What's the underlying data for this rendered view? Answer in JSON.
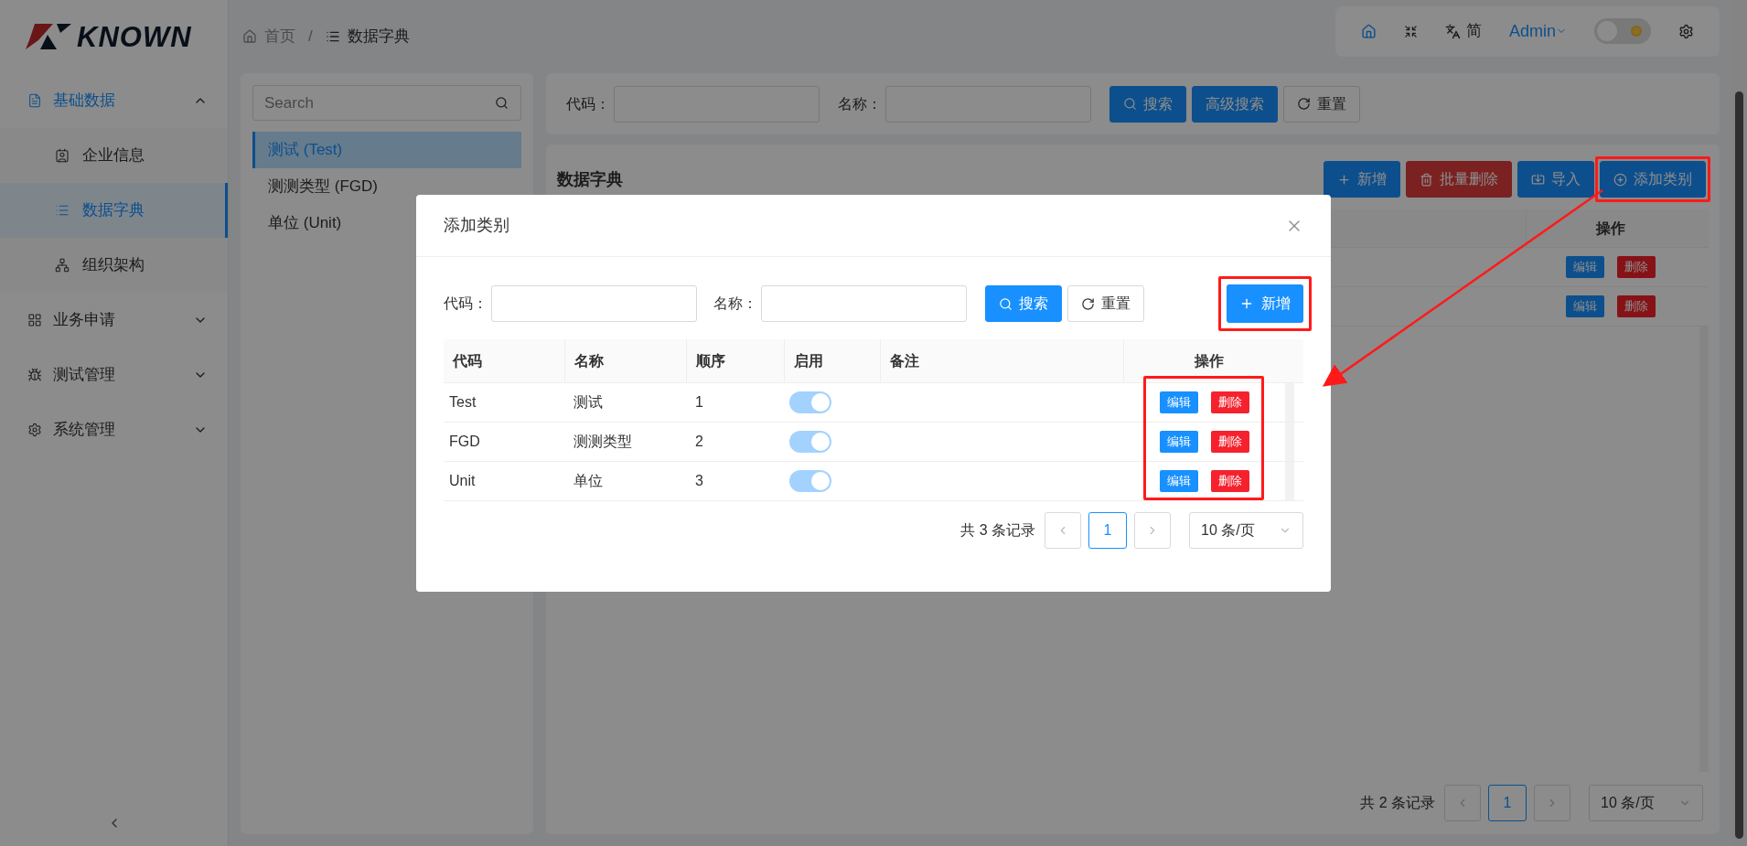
{
  "logo": {
    "text": "KNOWN"
  },
  "sidebar": {
    "items": [
      {
        "label": "基础数据",
        "kind": "data",
        "expanded": true,
        "children": [
          {
            "label": "企业信息",
            "kind": "company",
            "selected": false
          },
          {
            "label": "数据字典",
            "kind": "dictionary",
            "selected": true
          },
          {
            "label": "组织架构",
            "kind": "org",
            "selected": false
          }
        ]
      },
      {
        "label": "业务申请",
        "kind": "apply",
        "expanded": false
      },
      {
        "label": "测试管理",
        "kind": "test",
        "expanded": false
      },
      {
        "label": "系统管理",
        "kind": "system",
        "expanded": false
      }
    ]
  },
  "breadcrumb": {
    "separator": "/",
    "items": [
      {
        "label": "首页",
        "kind": "home"
      },
      {
        "label": "数据字典",
        "kind": "list"
      }
    ]
  },
  "header": {
    "language": "简",
    "user": "Admin",
    "dark_mode": false
  },
  "tree": {
    "search_placeholder": "Search",
    "items": [
      {
        "label": "测试 (Test)",
        "selected": true
      },
      {
        "label": "测测类型 (FGD)",
        "selected": false
      },
      {
        "label": "单位 (Unit)",
        "selected": false
      }
    ]
  },
  "filter": {
    "fields": [
      {
        "label": "代码："
      },
      {
        "label": "名称："
      }
    ],
    "buttons": [
      {
        "label": "搜索",
        "kind": "search"
      },
      {
        "label": "高级搜索",
        "kind": "advanced"
      },
      {
        "label": "重置",
        "kind": "reset"
      }
    ]
  },
  "panel": {
    "title": "数据字典",
    "actions": [
      {
        "label": "新增",
        "kind": "add",
        "highlighted": false
      },
      {
        "label": "批量删除",
        "kind": "batch_delete",
        "highlighted": false
      },
      {
        "label": "导入",
        "kind": "import",
        "highlighted": false
      },
      {
        "label": "添加类别",
        "kind": "add_category",
        "highlighted": true
      }
    ],
    "table": {
      "action_header": "操作",
      "rows": [
        {
          "actions": [
            {
              "label": "编辑",
              "kind": "edit"
            },
            {
              "label": "删除",
              "kind": "delete"
            }
          ]
        },
        {
          "actions": [
            {
              "label": "编辑",
              "kind": "edit"
            },
            {
              "label": "删除",
              "kind": "delete"
            }
          ]
        }
      ]
    },
    "pagination": {
      "total": "共 2 条记录",
      "pages": [
        {
          "label": "1",
          "selected": true
        }
      ],
      "page_size": "10 条/页"
    }
  },
  "dialog": {
    "title": "添加类别",
    "fields": [
      {
        "label": "代码："
      },
      {
        "label": "名称："
      }
    ],
    "buttons": [
      {
        "label": "搜索",
        "kind": "search"
      },
      {
        "label": "重置",
        "kind": "reset"
      }
    ],
    "add_button": {
      "label": "新增",
      "highlighted": true
    },
    "table": {
      "columns": [
        "代码",
        "名称",
        "顺序",
        "启用",
        "备注",
        "操作"
      ],
      "actions_highlighted": true,
      "rows": [
        {
          "code": "Test",
          "name": "测试",
          "order": "1",
          "enabled": true,
          "actions": [
            {
              "label": "编辑",
              "kind": "edit"
            },
            {
              "label": "删除",
              "kind": "delete"
            }
          ]
        },
        {
          "code": "FGD",
          "name": "测测类型",
          "order": "2",
          "enabled": true,
          "actions": [
            {
              "label": "编辑",
              "kind": "edit"
            },
            {
              "label": "删除",
              "kind": "delete"
            }
          ]
        },
        {
          "code": "Unit",
          "name": "单位",
          "order": "3",
          "enabled": true,
          "actions": [
            {
              "label": "编辑",
              "kind": "edit"
            },
            {
              "label": "删除",
              "kind": "delete"
            }
          ]
        }
      ]
    },
    "pagination": {
      "total": "共 3 条记录",
      "pages": [
        {
          "label": "1",
          "selected": true
        }
      ],
      "page_size": "10 条/页"
    }
  }
}
